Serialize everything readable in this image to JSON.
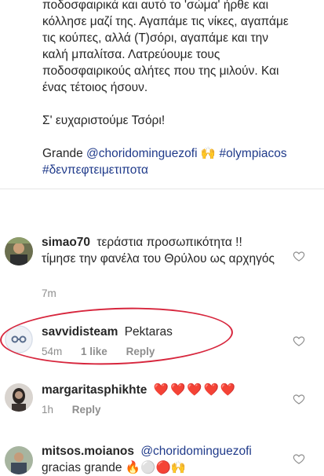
{
  "caption": {
    "partial_line": "ποδοσφαιρικά και αυτό το 'σώμα' ήρθε και",
    "line1": "κόλλησε μαζί της. Αγαπάμε τις νίκες, αγαπάμε",
    "line2": "τις κούπες, αλλά (Τ)σόρι, αγαπάμε και την",
    "line3": "καλή μπαλίτσα. Λατρεύουμε τους",
    "line4": "ποδοσφαιρικούς αλήτες που της μιλούν. Και",
    "line5": "ένας τέτοιος ήσουν.",
    "thanks": "Σ' ευχαριστούμε Τσόρι!",
    "grande": "Grande",
    "mention": "@choridominguezofi",
    "emoji": "🙌",
    "hashtag1": "#olympiacos",
    "hashtag2": "#δενπεφτειμετιποτα"
  },
  "comments": [
    {
      "username": "simao70",
      "text": "τεράστια προσωπικότητα !! τίμησε την φανέλα του Θρύλου ως αρχηγός",
      "time": "7m",
      "likes": "",
      "reply": ""
    },
    {
      "username": "savvidisteam",
      "text": "Pektaras",
      "time": "54m",
      "likes": "1 like",
      "reply": "Reply"
    },
    {
      "username": "margaritasphikhte",
      "text": "❤️❤️❤️❤️❤️",
      "time": "1h",
      "likes": "",
      "reply": "Reply"
    },
    {
      "username": "mitsos.moianos",
      "mention": "@choridominguezofi",
      "text": "gracias grande 🔥⚪🔴🙌",
      "time": "",
      "likes": "",
      "reply": ""
    }
  ],
  "colors": {
    "link": "#1f3a8a",
    "meta": "#8e8e8e",
    "annotation_circle": "#d7263d"
  }
}
